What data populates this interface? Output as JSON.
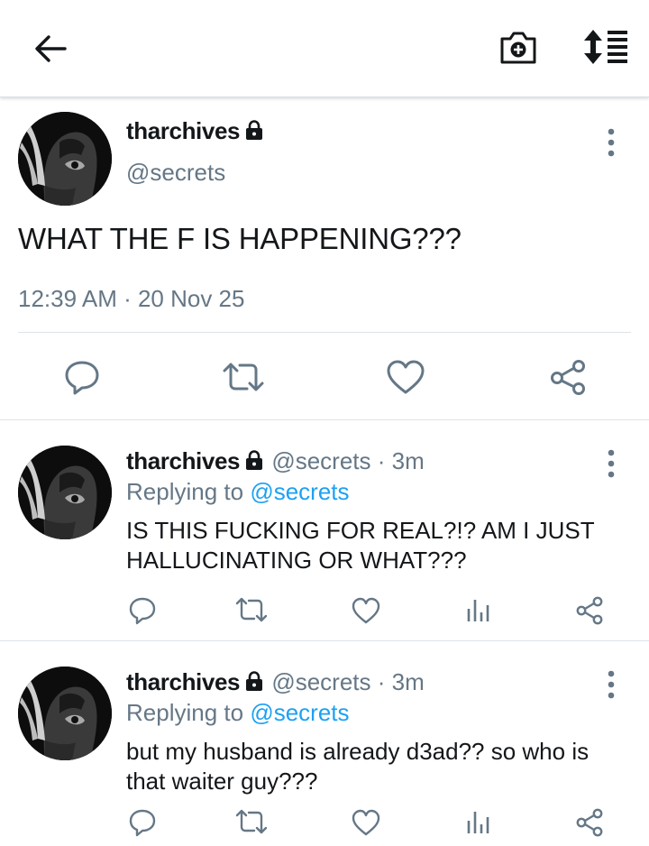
{
  "header": {
    "back_icon": "arrow-left-icon",
    "camera_icon": "camera-add-icon",
    "sort_icon": "sort-list-icon"
  },
  "main_tweet": {
    "display_name": "tharchives",
    "handle": "@secrets",
    "text": "WHAT THE F IS HAPPENING???",
    "timestamp": "12:39 AM · 20 Nov 25",
    "actions": [
      "reply-icon",
      "retweet-icon",
      "like-icon",
      "share-icon"
    ]
  },
  "replies": [
    {
      "display_name": "tharchives",
      "handle_time": "@secrets · 3m",
      "replying_prefix": "Replying to",
      "replying_to": "@secrets",
      "text": "IS THIS FUCKING FOR REAL?!? AM I JUST HALLUCINATING OR WHAT???"
    },
    {
      "display_name": "tharchives",
      "handle_time": "@secrets · 3m",
      "replying_prefix": "Replying to",
      "replying_to": "@secrets",
      "text": "but my husband is already d3ad?? so who is that waiter guy???"
    }
  ],
  "colors": {
    "text": "#14171a",
    "secondary": "#657786",
    "accent": "#1da1f2",
    "divider": "#dfe3e7"
  }
}
